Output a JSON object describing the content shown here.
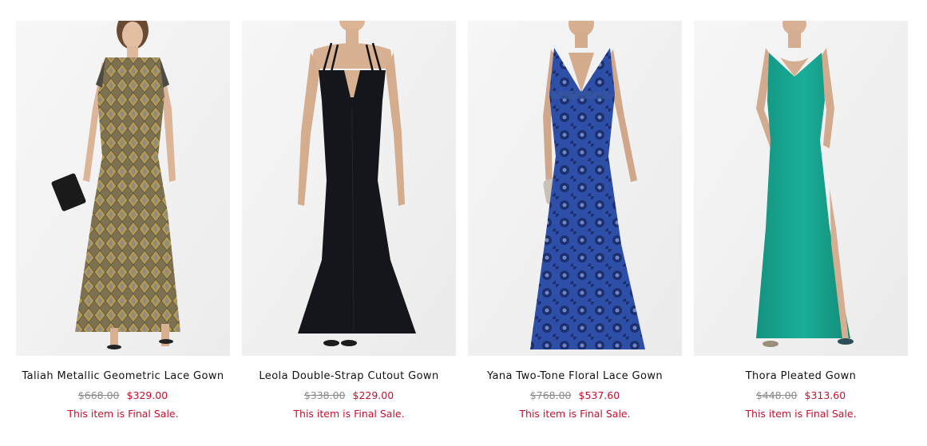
{
  "products": [
    {
      "name": "Taliah Metallic Geometric Lace Gown",
      "original_price": "$668.00",
      "sale_price": "$329.00",
      "sale_note": "This item is Final Sale.",
      "dress_color": "#8a7c55",
      "image_alt": "woman in metallic geometric lace gown"
    },
    {
      "name": "Leola Double-Strap Cutout Gown",
      "original_price": "$338.00",
      "sale_price": "$229.00",
      "sale_note": "This item is Final Sale.",
      "dress_color": "#15161c",
      "image_alt": "woman in black double-strap cutout gown"
    },
    {
      "name": "Yana Two-Tone Floral Lace Gown",
      "original_price": "$768.00",
      "sale_price": "$537.60",
      "sale_note": "This item is Final Sale.",
      "dress_color": "#2e4fa8",
      "image_alt": "woman in blue floral lace gown"
    },
    {
      "name": "Thora Pleated Gown",
      "original_price": "$448.00",
      "sale_price": "$313.60",
      "sale_note": "This item is Final Sale.",
      "dress_color": "#16a08c",
      "image_alt": "woman in teal pleated gown"
    }
  ],
  "colors": {
    "sale_red": "#c8102e",
    "strike_gray": "#8a8a8a",
    "photo_background": "#f3f3f3"
  }
}
